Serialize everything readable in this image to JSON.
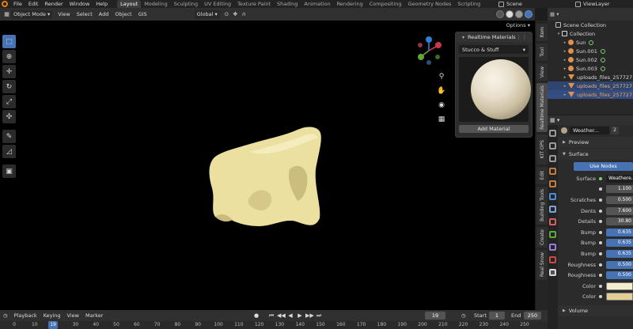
{
  "app": {
    "menus": [
      "File",
      "Edit",
      "Render",
      "Window",
      "Help"
    ],
    "workspaces": [
      "Layout",
      "Modeling",
      "Sculpting",
      "UV Editing",
      "Texture Paint",
      "Shading",
      "Animation",
      "Rendering",
      "Compositing",
      "Geometry Nodes",
      "Scripting"
    ],
    "active_workspace": "Layout",
    "scene": "Scene",
    "view_layer": "ViewLayer"
  },
  "viewport_header": {
    "mode": "Object Mode",
    "menus": [
      "View",
      "Select",
      "Add",
      "Object",
      "GIS"
    ],
    "orientation": "Global",
    "options": "Options"
  },
  "toolbar": {
    "tools": [
      "select-box-icon",
      "cursor-icon",
      "move-icon",
      "rotate-icon",
      "scale-icon",
      "transform-icon",
      "annotate-icon",
      "measure-icon",
      "add-cube-icon"
    ]
  },
  "realtime_materials": {
    "title": "Realtime Materials",
    "category": "Stucco & Stuff",
    "add_button": "Add Material"
  },
  "n_panel_tabs": [
    "Item",
    "Tool",
    "View",
    "Realtime Materials",
    "KIT OPS",
    "Edit",
    "Building Tools",
    "Create",
    "Real Snow"
  ],
  "outliner": {
    "rows": [
      {
        "label": "Scene Collection",
        "icon": "scene-collection-icon",
        "indent": 0
      },
      {
        "label": "Collection",
        "icon": "collection-icon",
        "indent": 1
      },
      {
        "label": "Sun",
        "icon": "sun-icon",
        "indent": 2
      },
      {
        "label": "Sun.001",
        "icon": "sun-icon",
        "indent": 2
      },
      {
        "label": "Sun.002",
        "icon": "sun-icon",
        "indent": 2
      },
      {
        "label": "Sun.003",
        "icon": "sun-icon",
        "indent": 2
      },
      {
        "label": "uploads_files_257727",
        "icon": "mesh-icon",
        "indent": 2
      },
      {
        "label": "uploads_files_257727",
        "icon": "mesh-icon",
        "indent": 2
      },
      {
        "label": "uploads_files_257727",
        "icon": "mesh-icon",
        "indent": 2
      }
    ]
  },
  "properties": {
    "material_name": "Weather...",
    "material_users": "2",
    "sections": {
      "preview": "Preview",
      "surface": "Surface",
      "volume": "Volume"
    },
    "use_nodes": "Use Nodes",
    "surface_label": "Surface",
    "surface_value": "Weathere...",
    "rows": [
      {
        "label": "",
        "value": "1.100",
        "kind": "plain"
      },
      {
        "label": "Scratches",
        "value": "0.500",
        "kind": "plain"
      },
      {
        "label": "Dents",
        "value": "7.600",
        "kind": "plain"
      },
      {
        "label": "Details",
        "value": "30.80",
        "kind": "plain"
      },
      {
        "label": "Bump",
        "value": "0.635",
        "kind": "blue"
      },
      {
        "label": "Bump",
        "value": "0.635",
        "kind": "blue"
      },
      {
        "label": "Bump",
        "value": "0.635",
        "kind": "blue"
      },
      {
        "label": "Roughness",
        "value": "0.500",
        "kind": "blue"
      },
      {
        "label": "Roughness",
        "value": "0.500",
        "kind": "blue"
      },
      {
        "label": "Color",
        "value": "",
        "kind": "swatch",
        "color": "#f3eccd"
      },
      {
        "label": "Color",
        "value": "",
        "kind": "swatch",
        "color": "#e3cf96"
      }
    ]
  },
  "timeline": {
    "menus": [
      "Playback",
      "Keying",
      "View",
      "Marker"
    ],
    "current_frame": "19",
    "start_label": "Start",
    "start_value": "1",
    "end_label": "End",
    "end_value": "250",
    "ruler_ticks": [
      "0",
      "10",
      "20",
      "30",
      "40",
      "50",
      "60",
      "70",
      "80",
      "90",
      "100",
      "110",
      "120",
      "130",
      "140",
      "150",
      "160",
      "170",
      "180",
      "190",
      "200",
      "210",
      "220",
      "230",
      "240",
      "250"
    ]
  },
  "colors": {
    "accent": "#4772b3",
    "model": "#ece0a0",
    "viewport_bg": "#000000"
  }
}
